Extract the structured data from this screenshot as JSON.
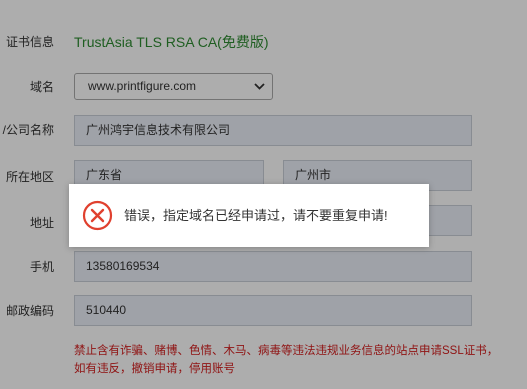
{
  "form": {
    "cert_info_label": "证书信息",
    "cert_info_value": "TrustAsia TLS RSA CA(免费版)",
    "domain_label": "域名",
    "domain_value": "www.printfigure.com",
    "company_label": "/公司名称",
    "company_value": "广州鸿宇信息技术有限公司",
    "region_label": "所在地区",
    "province_value": "广东省",
    "city_value": "广州市",
    "address_label": "地址",
    "address_value": "",
    "phone_label": "手机",
    "phone_value": "13580169534",
    "postcode_label": "邮政编码",
    "postcode_value": "510440",
    "warning_line1": "禁止含有诈骗、赌博、色情、木马、病毒等违法违规业务信息的站点申请SSL证书，",
    "warning_line2": "如有违反，撤销申请，停用账号"
  },
  "dialog": {
    "icon": "error-circle-x-icon",
    "message": "错误，指定域名已经申请过，请不要重复申请!"
  },
  "colors": {
    "cert_value": "#2e8b32",
    "warning_text": "#d42020",
    "error_icon": "#e0402e",
    "field_bg": "#ebeff8"
  }
}
